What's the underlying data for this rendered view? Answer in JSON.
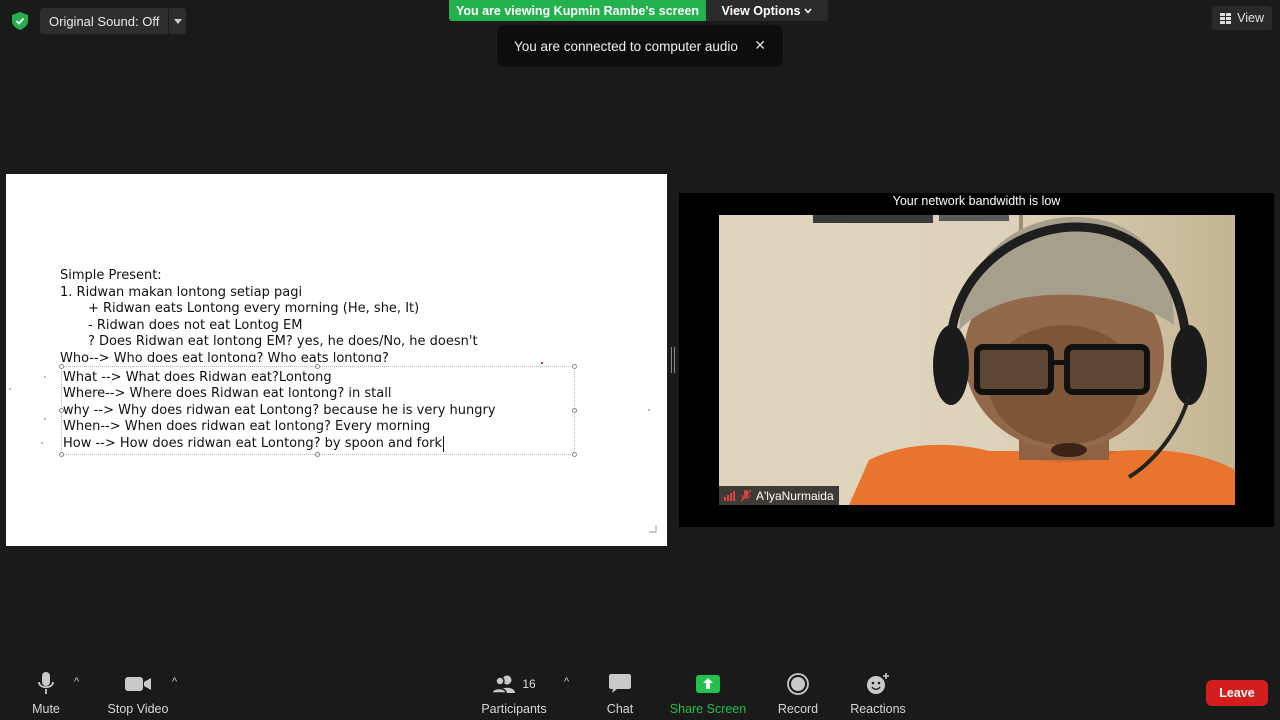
{
  "topbar": {
    "original_sound_label": "Original Sound: Off",
    "viewing_banner": "You are viewing Kupmin Rambe's screen",
    "view_options_label": "View Options",
    "view_label": "View"
  },
  "toast": {
    "message": "You are connected to computer audio",
    "close_glyph": "✕"
  },
  "slide": {
    "lines": [
      "Simple Present:",
      "1. Ridwan makan lontong setiap pagi",
      "+ Ridwan eats Lontong every morning (He, she, It)",
      "- Ridwan does not eat Lontog EM",
      "? Does Ridwan eat lontong EM? yes, he does/No, he doesn't",
      "Who--> Who does eat lontong? Who eats lontong?",
      "What --> What does Ridwan eat?Lontong",
      "Where--> Where does Ridwan eat lontong? in stall",
      "why --> Why does ridwan eat Lontong? because he is very hungry",
      "When--> When does ridwan eat lontong? Every morning",
      "How --> How does ridwan eat Lontong? by spoon and fork"
    ]
  },
  "video": {
    "bandwidth_message": "Your network bandwidth is low",
    "participant_name": "A'lyaNurmaida"
  },
  "toolbar": {
    "mute_label": "Mute",
    "stop_video_label": "Stop Video",
    "participants_label": "Participants",
    "participants_count": "16",
    "chat_label": "Chat",
    "share_screen_label": "Share Screen",
    "record_label": "Record",
    "reactions_label": "Reactions",
    "leave_label": "Leave",
    "caret_glyph": "^"
  },
  "colors": {
    "banner_green": "#23b14d",
    "share_green": "#23c04a",
    "leave_red": "#d41e1e",
    "background": "#1a1a1a"
  }
}
